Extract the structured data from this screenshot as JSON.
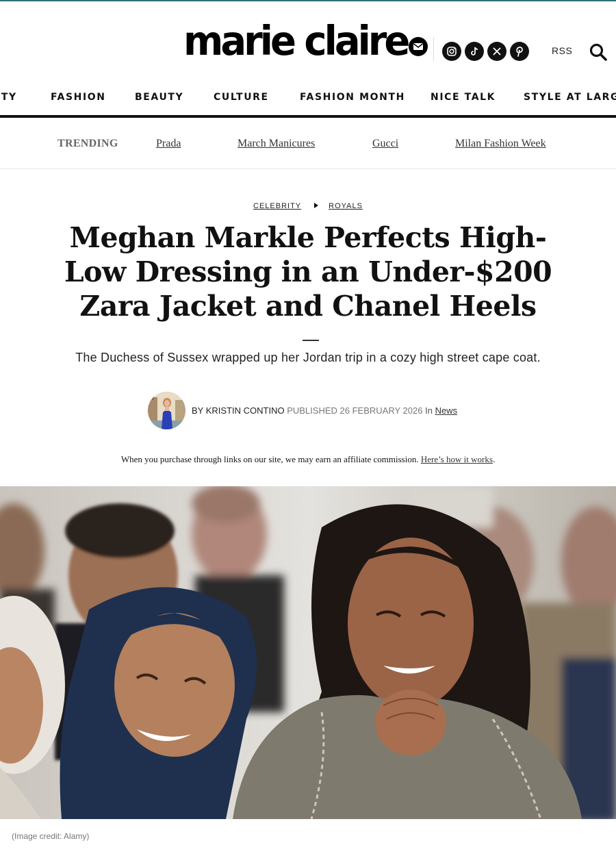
{
  "brand": {
    "logo_text": "marie claire"
  },
  "header": {
    "rss_label": "RSS"
  },
  "social_icons": [
    {
      "name": "instagram-icon",
      "glyph": "◎"
    },
    {
      "name": "tiktok-icon",
      "glyph": "♪"
    },
    {
      "name": "x-icon",
      "glyph": "𝕏"
    },
    {
      "name": "pinterest-icon",
      "glyph": "P"
    }
  ],
  "nav": {
    "items": [
      "ITY",
      "FASHION",
      "BEAUTY",
      "CULTURE",
      "FASHION MONTH",
      "NICE TALK",
      "STYLE AT LARGE"
    ]
  },
  "trending": {
    "label": "TRENDING",
    "links": [
      "Prada",
      "March Manicures",
      "Gucci",
      "Milan Fashion Week"
    ]
  },
  "breadcrumb": {
    "first": "CELEBRITY",
    "second": "ROYALS"
  },
  "article": {
    "headline": "Meghan Markle Perfects High-Low Dressing in an Under-$200 Zara Jacket and Chanel Heels",
    "strap": "The Duchess of Sussex wrapped up her Jordan trip in a cozy high street cape coat.",
    "byline_prefix": "BY",
    "author": "KRISTIN CONTINO",
    "published_label": "PUBLISHED",
    "published_date": "26 FEBRUARY 2026",
    "in_label": "In",
    "category": "News"
  },
  "affiliate": {
    "text": "When you purchase through links on our site, we may earn an affiliate commission.",
    "link": "Here’s how it works",
    "suffix": "."
  },
  "hero": {
    "credit": "(Image credit: Alamy)"
  }
}
